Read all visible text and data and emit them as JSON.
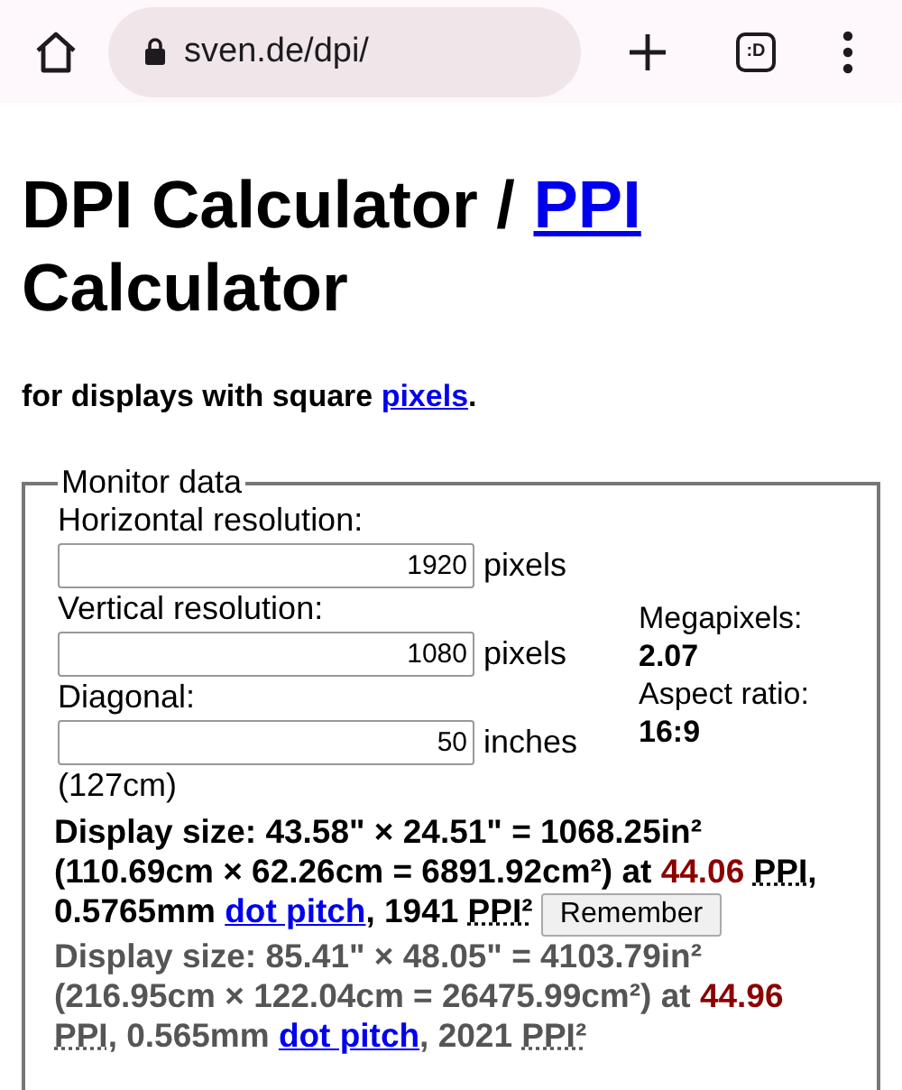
{
  "browser": {
    "url": "sven.de/dpi/",
    "tab_label": ":D"
  },
  "heading": {
    "text": "DPI Calculator / ",
    "link": "PPI",
    "after": "Calculator"
  },
  "subtitle": {
    "text": "for displays with square ",
    "link": "pixels",
    "after": "."
  },
  "monitor": {
    "legend": "Monitor data",
    "fields": [
      {
        "label": "Horizontal resolution:",
        "value": "1920",
        "unit": "pixels"
      },
      {
        "label": "Vertical resolution:",
        "value": "1080",
        "unit": "pixels"
      },
      {
        "label": "Diagonal:",
        "value": "50",
        "unit": "inches",
        "note": "(127cm)"
      }
    ],
    "stats": [
      {
        "label": "Megapixels:",
        "value": "2.07"
      },
      {
        "label": "Aspect ratio:",
        "value": "16:9"
      }
    ]
  },
  "results": [
    {
      "current": true,
      "button": "Remember",
      "parts": [
        {
          "kind": "text",
          "text": "Display size: 43.58\" × 24.51\" = 1068.25in² (110.69cm × 62.26cm = 6891.92cm²) at "
        },
        {
          "kind": "value",
          "text": "44.06 "
        },
        {
          "kind": "abbr",
          "text": "PPI"
        },
        {
          "kind": "text",
          "text": ", 0.5765mm "
        },
        {
          "kind": "link",
          "text": "dot pitch"
        },
        {
          "kind": "text",
          "text": ", 1941 "
        },
        {
          "kind": "abbr",
          "text": "PPI²"
        }
      ]
    },
    {
      "current": false,
      "parts": [
        {
          "kind": "text",
          "text": "Display size: 85.41\" × 48.05\" = 4103.79in² (216.95cm × 122.04cm = 26475.99cm²) at "
        },
        {
          "kind": "value",
          "text": "44.96 "
        },
        {
          "kind": "abbr",
          "text": "PPI"
        },
        {
          "kind": "text",
          "text": ", 0.565mm "
        },
        {
          "kind": "link",
          "text": "dot pitch"
        },
        {
          "kind": "text",
          "text": ", 2021 "
        },
        {
          "kind": "abbr",
          "text": "PPI²"
        }
      ]
    }
  ]
}
